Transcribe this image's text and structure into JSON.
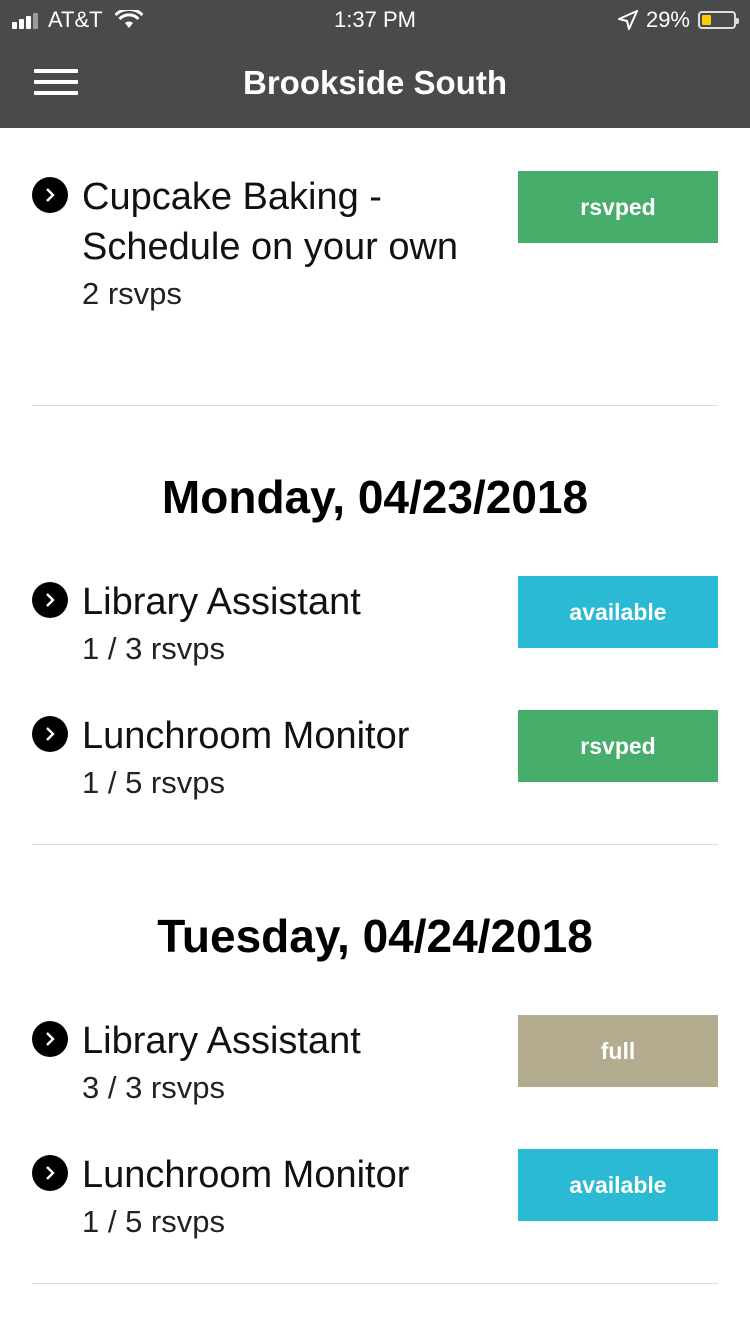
{
  "status_bar": {
    "carrier": "AT&T",
    "time": "1:37 PM",
    "battery": "29%",
    "battery_level": 0.29,
    "icons": [
      "signal-icon",
      "wifi-icon",
      "location-arrow-icon",
      "battery-icon"
    ]
  },
  "nav": {
    "title": "Brookside South",
    "menu_icon": "hamburger-menu-icon"
  },
  "colors": {
    "header_bg": "#4a4a4a",
    "rsvped": "#46ad6b",
    "available": "#2bbad4",
    "full": "#b2ab8d"
  },
  "sections": [
    {
      "header": "",
      "items": [
        {
          "title": "Cupcake Baking - Schedule on your own",
          "rsvps": "2 rsvps",
          "status": "rsvped"
        }
      ]
    },
    {
      "header": "Monday, 04/23/2018",
      "items": [
        {
          "title": "Library Assistant",
          "rsvps": "1 / 3 rsvps",
          "status": "available"
        },
        {
          "title": "Lunchroom Monitor",
          "rsvps": "1 / 5 rsvps",
          "status": "rsvped"
        }
      ]
    },
    {
      "header": "Tuesday, 04/24/2018",
      "items": [
        {
          "title": "Library Assistant",
          "rsvps": "3 / 3 rsvps",
          "status": "full"
        },
        {
          "title": "Lunchroom Monitor",
          "rsvps": "1 / 5 rsvps",
          "status": "available"
        }
      ]
    }
  ]
}
